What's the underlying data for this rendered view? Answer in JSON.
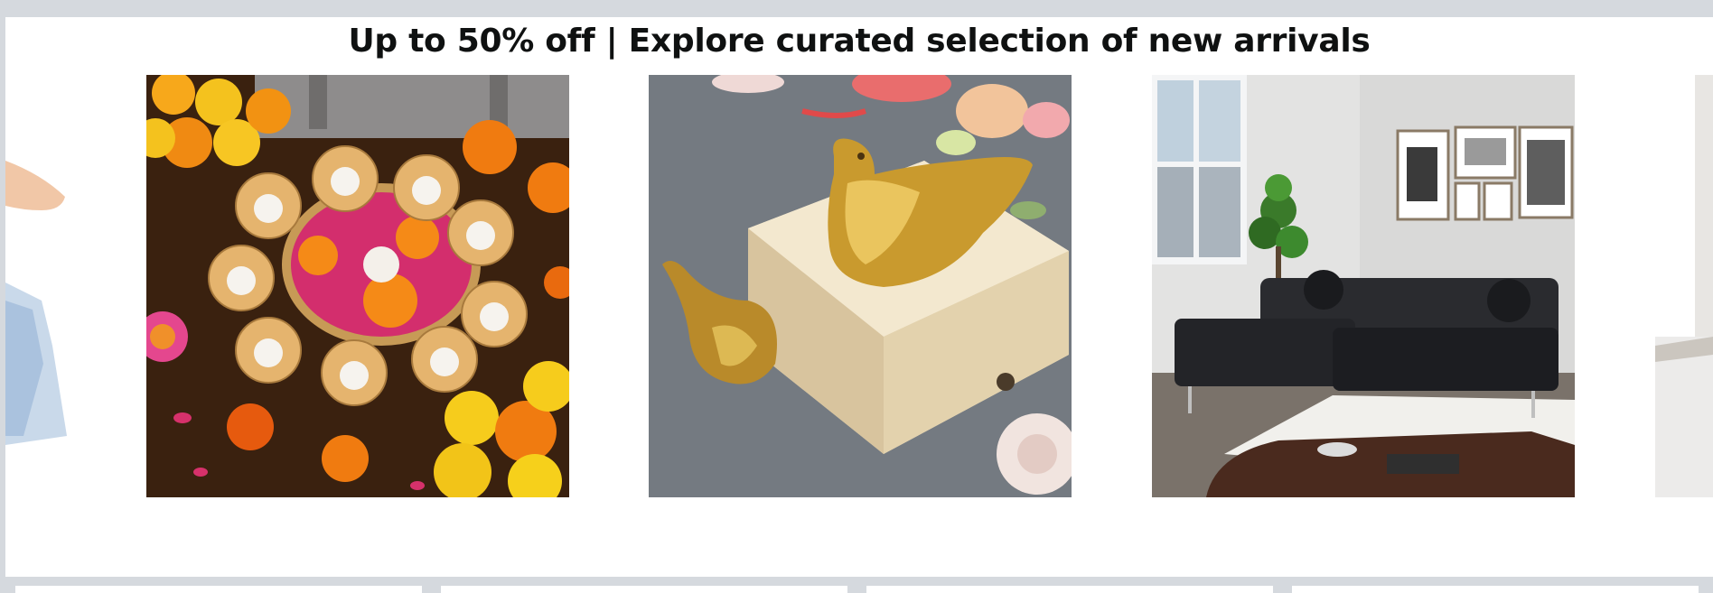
{
  "carousel": {
    "headline": "Up to 50% off | Explore curated selection of new arrivals",
    "items": [
      {
        "name": "Partial fashion product tile",
        "icon": "dress-image"
      },
      {
        "name": "Lotus tealight diya set with marigolds",
        "icon": "diya-image"
      },
      {
        "name": "Gold bird figurines on wooden tray",
        "icon": "bird-decor-image"
      },
      {
        "name": "Black sectional sofa in living room",
        "icon": "sofa-image"
      },
      {
        "name": "Partial home product tile",
        "icon": "partial-image"
      }
    ]
  },
  "colors": {
    "page_background": "#d5d9de",
    "card_background": "#ffffff",
    "headline_text": "#0f1111"
  }
}
